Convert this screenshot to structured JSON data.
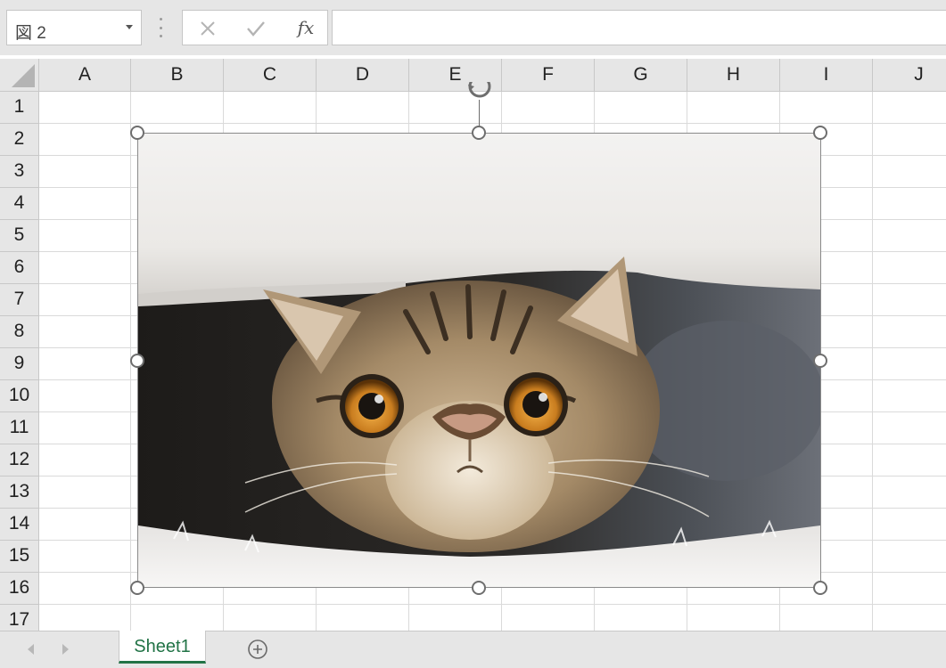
{
  "formula_bar": {
    "name_box_value": "図 2",
    "cancel_icon": "close-icon",
    "enter_icon": "check-icon",
    "function_label": "fx",
    "formula_value": ""
  },
  "columns": [
    "A",
    "B",
    "C",
    "D",
    "E",
    "F",
    "G",
    "H",
    "I",
    "J"
  ],
  "rows": [
    "1",
    "2",
    "3",
    "4",
    "5",
    "6",
    "7",
    "8",
    "9",
    "10",
    "11",
    "12",
    "13",
    "14",
    "15",
    "16",
    "17"
  ],
  "picture": {
    "name": "図 2",
    "content": "cat-photo",
    "selected": true
  },
  "sheet_tabs": {
    "tabs": [
      {
        "label": "Sheet1",
        "active": true
      }
    ],
    "add_icon": "plus-circle-icon",
    "nav_icons": [
      "chevron-left-icon",
      "chevron-right-icon"
    ]
  },
  "colors": {
    "accent": "#217346",
    "toolbar_bg": "#e6e6e6",
    "gridline": "#dadada",
    "header_border": "#c8c8c8",
    "handle_border": "#6e6e6e"
  }
}
